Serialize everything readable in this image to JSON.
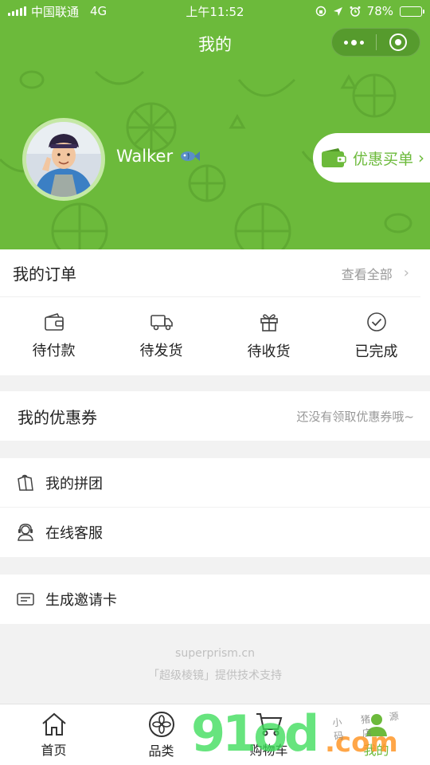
{
  "status_bar": {
    "carrier": "中国联通",
    "network": "4G",
    "time": "上午11:52",
    "battery": "78%",
    "battery_level": 0.78
  },
  "nav": {
    "title": "我的"
  },
  "profile": {
    "username": "Walker",
    "coupon_button": "优惠买单"
  },
  "orders": {
    "title": "我的订单",
    "view_all": "查看全部",
    "tabs": [
      {
        "label": "待付款",
        "icon": "wallet-icon"
      },
      {
        "label": "待发货",
        "icon": "truck-icon"
      },
      {
        "label": "待收货",
        "icon": "gift-icon"
      },
      {
        "label": "已完成",
        "icon": "check-circle-icon"
      }
    ]
  },
  "coupons": {
    "title": "我的优惠券",
    "hint": "还没有领取优惠券哦~"
  },
  "menu": [
    {
      "label": "我的拼团",
      "icon": "group-buy-icon"
    },
    {
      "label": "在线客服",
      "icon": "customer-service-icon"
    },
    {
      "label": "生成邀请卡",
      "icon": "invite-card-icon"
    }
  ],
  "footer": {
    "domain": "superprism.cn",
    "credit": "「超级棱镜」提供技术支持"
  },
  "tabbar": [
    {
      "label": "首页",
      "icon": "home-icon"
    },
    {
      "label": "品类",
      "icon": "category-icon"
    },
    {
      "label": "购物车",
      "icon": "cart-icon"
    },
    {
      "label": "我的",
      "icon": "profile-icon",
      "active": true
    }
  ],
  "colors": {
    "brand_green": "#6cba3b",
    "text_primary": "#222222",
    "text_muted": "#999999"
  },
  "watermark": {
    "numerals": "91",
    "letters": "od",
    "suffix": ".com",
    "small_text": "小 猪 源 码 店"
  }
}
